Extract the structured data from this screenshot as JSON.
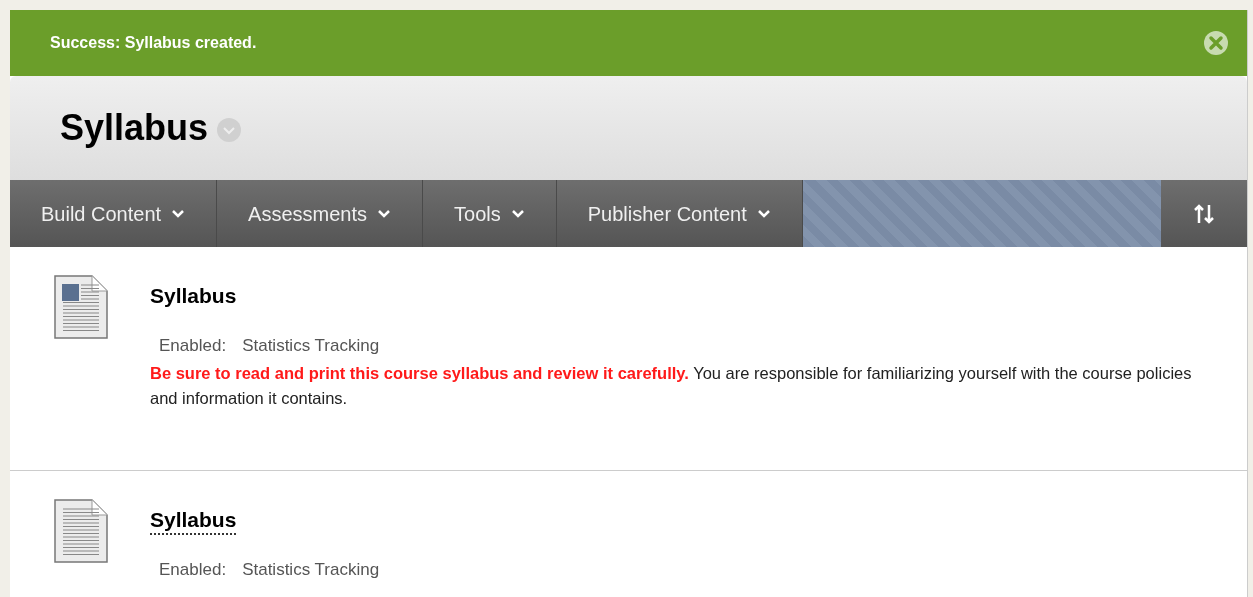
{
  "banner": {
    "message": "Success: Syllabus created."
  },
  "page": {
    "title": "Syllabus"
  },
  "toolbar": {
    "menus": [
      {
        "label": "Build Content"
      },
      {
        "label": "Assessments"
      },
      {
        "label": "Tools"
      },
      {
        "label": "Publisher Content"
      }
    ]
  },
  "items": [
    {
      "kind": "image_document",
      "title": "Syllabus",
      "focused": false,
      "enabled_label": "Enabled:",
      "enabled_value": "Statistics Tracking",
      "description": {
        "emphasis": "Be sure to read and print this course syllabus and review it carefully.",
        "text": "You are responsible for familiarizing yourself with the course policies and information it contains."
      }
    },
    {
      "kind": "document",
      "title": "Syllabus",
      "focused": true,
      "enabled_label": "Enabled:",
      "enabled_value": "Statistics Tracking"
    }
  ]
}
